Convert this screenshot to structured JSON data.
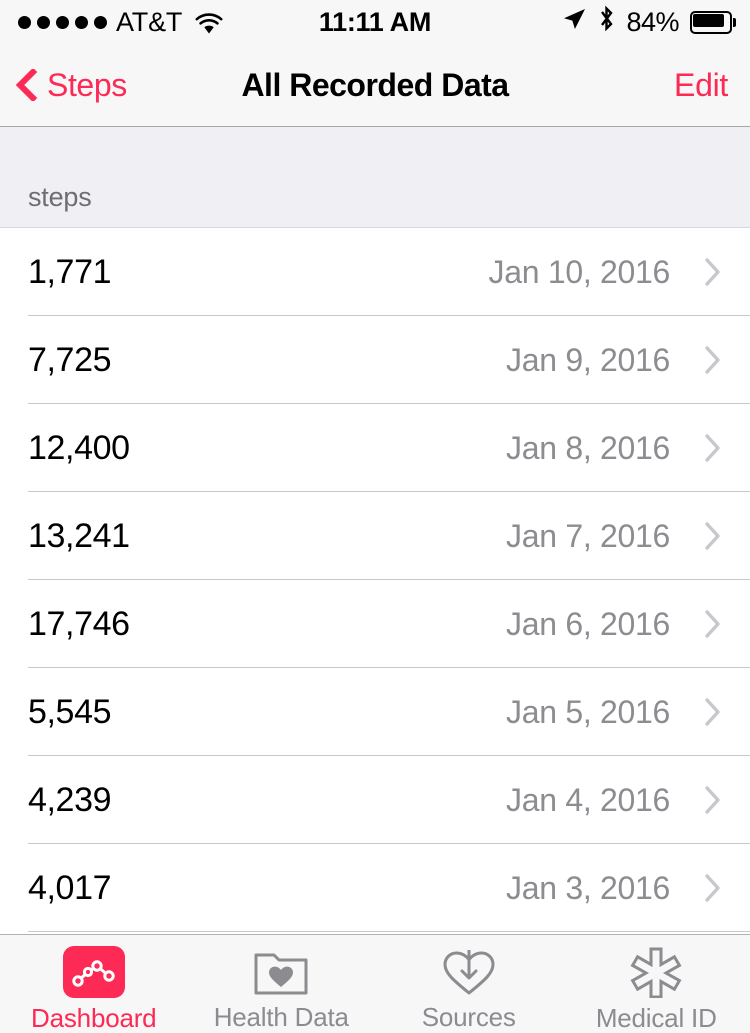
{
  "status_bar": {
    "signal_dots": 5,
    "carrier": "AT&T",
    "wifi_icon": "wifi-icon",
    "time": "11:11 AM",
    "location_icon": "location-arrow-icon",
    "bluetooth_icon": "bluetooth-icon",
    "battery_percent": "84%",
    "battery_level": 84
  },
  "nav_bar": {
    "back_label": "Steps",
    "back_icon": "chevron-left-icon",
    "title": "All Recorded Data",
    "edit_label": "Edit",
    "accent_color": "#fc2a55"
  },
  "list": {
    "section_header": "steps",
    "unit": "steps",
    "columns": [
      "value",
      "date"
    ],
    "rows": [
      {
        "value": "1,771",
        "date": "Jan 10, 2016",
        "disclosure": "chevron-right-icon"
      },
      {
        "value": "7,725",
        "date": "Jan 9, 2016",
        "disclosure": "chevron-right-icon"
      },
      {
        "value": "12,400",
        "date": "Jan 8, 2016",
        "disclosure": "chevron-right-icon"
      },
      {
        "value": "13,241",
        "date": "Jan 7, 2016",
        "disclosure": "chevron-right-icon"
      },
      {
        "value": "17,746",
        "date": "Jan 6, 2016",
        "disclosure": "chevron-right-icon"
      },
      {
        "value": "5,545",
        "date": "Jan 5, 2016",
        "disclosure": "chevron-right-icon"
      },
      {
        "value": "4,239",
        "date": "Jan 4, 2016",
        "disclosure": "chevron-right-icon"
      },
      {
        "value": "4,017",
        "date": "Jan 3, 2016",
        "disclosure": "chevron-right-icon"
      },
      {
        "value": "",
        "date": "",
        "disclosure": "chevron-right-icon"
      }
    ]
  },
  "tab_bar": {
    "tabs": [
      {
        "label": "Dashboard",
        "icon": "dashboard-chart-icon",
        "active": true
      },
      {
        "label": "Health Data",
        "icon": "folder-heart-icon",
        "active": false
      },
      {
        "label": "Sources",
        "icon": "heart-download-icon",
        "active": false
      },
      {
        "label": "Medical ID",
        "icon": "medical-asterisk-icon",
        "active": false
      }
    ],
    "active_color": "#fc2a55",
    "inactive_color": "#8b8b90"
  }
}
